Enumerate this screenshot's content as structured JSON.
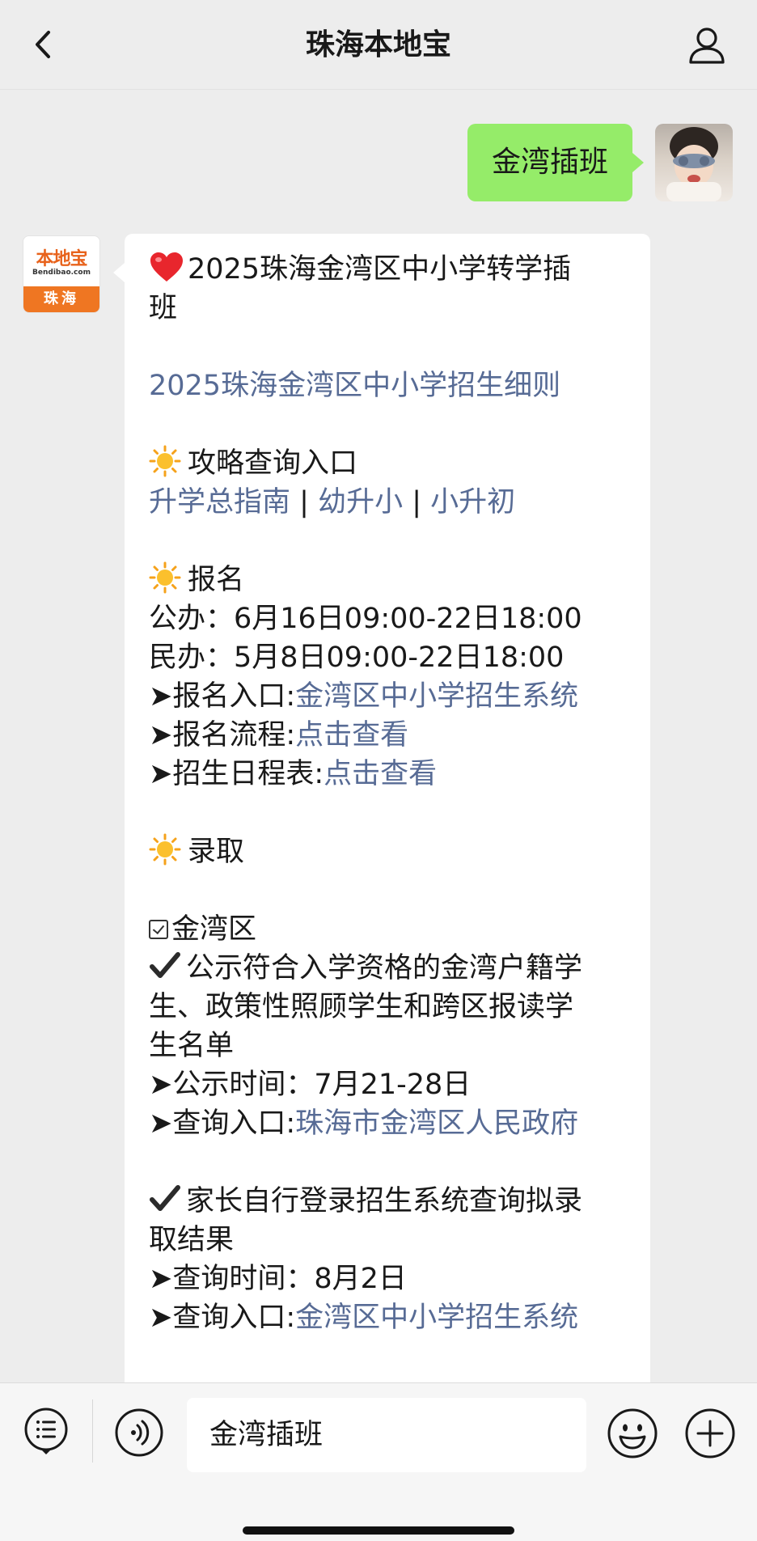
{
  "header": {
    "title": "珠海本地宝"
  },
  "outgoing": {
    "text": "金湾插班"
  },
  "bot": {
    "logo_name": "本地宝",
    "logo_url": "Bendibao.com",
    "logo_city": "珠海"
  },
  "message": {
    "title_line1": "2025珠海金湾区中小学转学插",
    "title_line2": "班",
    "rules_link": "2025珠海金湾区中小学招生细则",
    "guide_heading": "攻略查询入口",
    "guide_links": [
      "升学总指南",
      "幼升小",
      "小升初"
    ],
    "guide_sep": " | ",
    "signup_heading": "报名",
    "signup_public": "公办：6月16日09:00-22日18:00",
    "signup_private": "民办：5月8日09:00-22日18:00",
    "signup_entry_label": "➤报名入口:",
    "signup_entry_link": "金湾区中小学招生系统",
    "signup_flow_label": "➤报名流程:",
    "signup_flow_link": "点击查看",
    "schedule_label": "➤招生日程表:",
    "schedule_link": "点击查看",
    "admission_heading": "录取",
    "district": "金湾区",
    "notice_line1": "公示符合入学资格的金湾户籍学",
    "notice_line2": "生、政策性照顾学生和跨区报读学",
    "notice_line3": "生名单",
    "notice_time": "➤公示时间：7月21-28日",
    "notice_entry_label": "➤查询入口:",
    "notice_entry_link": "珠海市金湾区人民政府",
    "result_line1": "家长自行登录招生系统查询拟录",
    "result_line2": "取结果",
    "result_time": "➤查询时间：8月2日",
    "result_entry_label": "➤查询入口:",
    "result_entry_link": "金湾区中小学招生系统"
  },
  "input": {
    "value": "金湾插班"
  },
  "colors": {
    "link": "#576b95",
    "outgoing_bubble": "#95ec69",
    "background": "#ededed",
    "logo_orange": "#ef7622"
  },
  "icons": [
    "back-arrow-icon",
    "person-icon",
    "heart-icon",
    "sun-icon",
    "checkbox-icon",
    "checkmark-icon",
    "menu-icon",
    "voice-icon",
    "emoji-icon",
    "plus-icon"
  ]
}
